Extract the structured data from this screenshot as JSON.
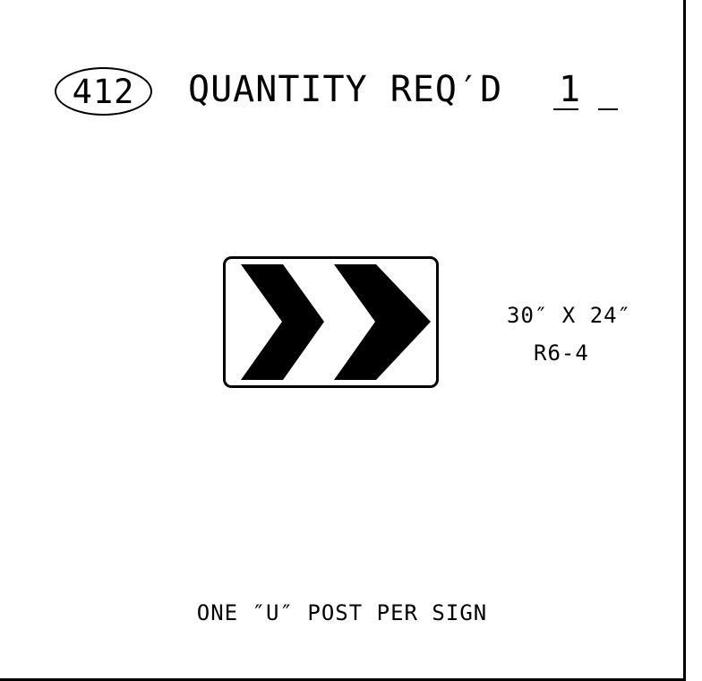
{
  "item": {
    "number": "412"
  },
  "quantity": {
    "label": "QUANTITY REQ′D",
    "value": "1"
  },
  "sign": {
    "size": "30″ X 24″",
    "code": "R6-4",
    "symbol": "double-chevron-right-icon",
    "colors": {
      "background": "#ffffff",
      "legend": "#000000",
      "border": "#000000"
    }
  },
  "post_note": "ONE ″U″ POST PER SIGN"
}
